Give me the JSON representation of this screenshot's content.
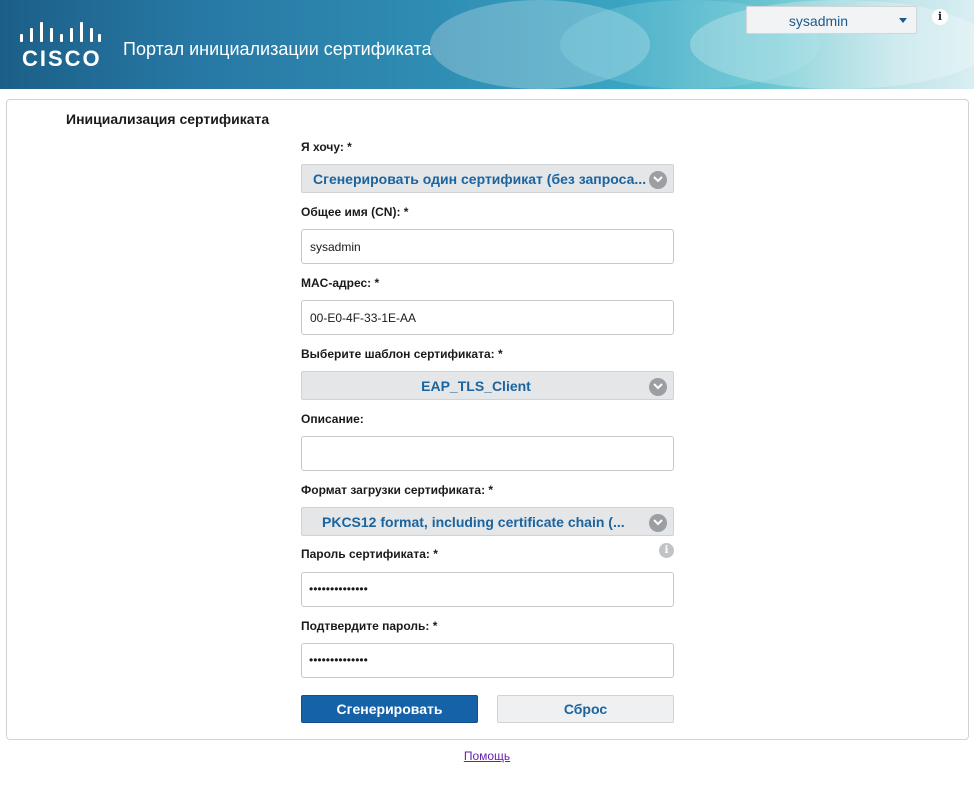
{
  "header": {
    "logo_text": "CISCO",
    "portal_title": "Портал инициализации сертификата",
    "user": "sysadmin",
    "info_icon": "i"
  },
  "form": {
    "section_title": "Инициализация сертификата",
    "i_want_label": "Я хочу: *",
    "i_want_value": "Сгенерировать один сертификат (без запроса...",
    "cn_label": "Общее имя (CN): *",
    "cn_value": "sysadmin",
    "mac_label": "MAC-адрес: *",
    "mac_value": "00-E0-4F-33-1E-AA",
    "template_label": "Выберите шаблон сертификата: *",
    "template_value": "EAP_TLS_Client",
    "description_label": "Описание:",
    "description_value": "",
    "format_label": "Формат загрузки сертификата: *",
    "format_value": "PKCS12 format, including certificate chain (...",
    "password_label": "Пароль сертификата: *",
    "password_value": "••••••••••••••",
    "confirm_label": "Подтвердите пароль: *",
    "confirm_value": "••••••••••••••",
    "generate_button": "Сгенерировать",
    "reset_button": "Сброс"
  },
  "footer": {
    "help_link": "Помощь"
  },
  "icons": [
    "cisco-logo-icon",
    "chevron-down-icon",
    "info-icon"
  ],
  "colors": {
    "accent": "#1662a8",
    "link_text": "#1a64a0",
    "header_gradient_start": "#1b5f88",
    "header_gradient_end": "#d9eef2"
  }
}
